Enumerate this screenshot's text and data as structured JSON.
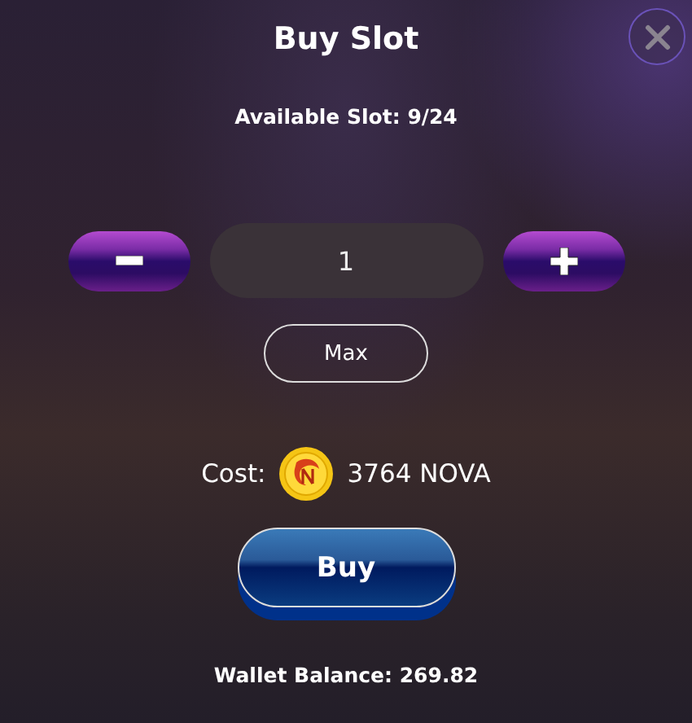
{
  "dialog": {
    "title": "Buy Slot",
    "available_slot": "Available Slot: 9/24"
  },
  "quantity": {
    "value": "1"
  },
  "max_button": "Max",
  "cost": {
    "label": "Cost:",
    "amount": "3764 NOVA"
  },
  "buy_button": "Buy",
  "wallet_balance": "Wallet Balance: 269.82"
}
